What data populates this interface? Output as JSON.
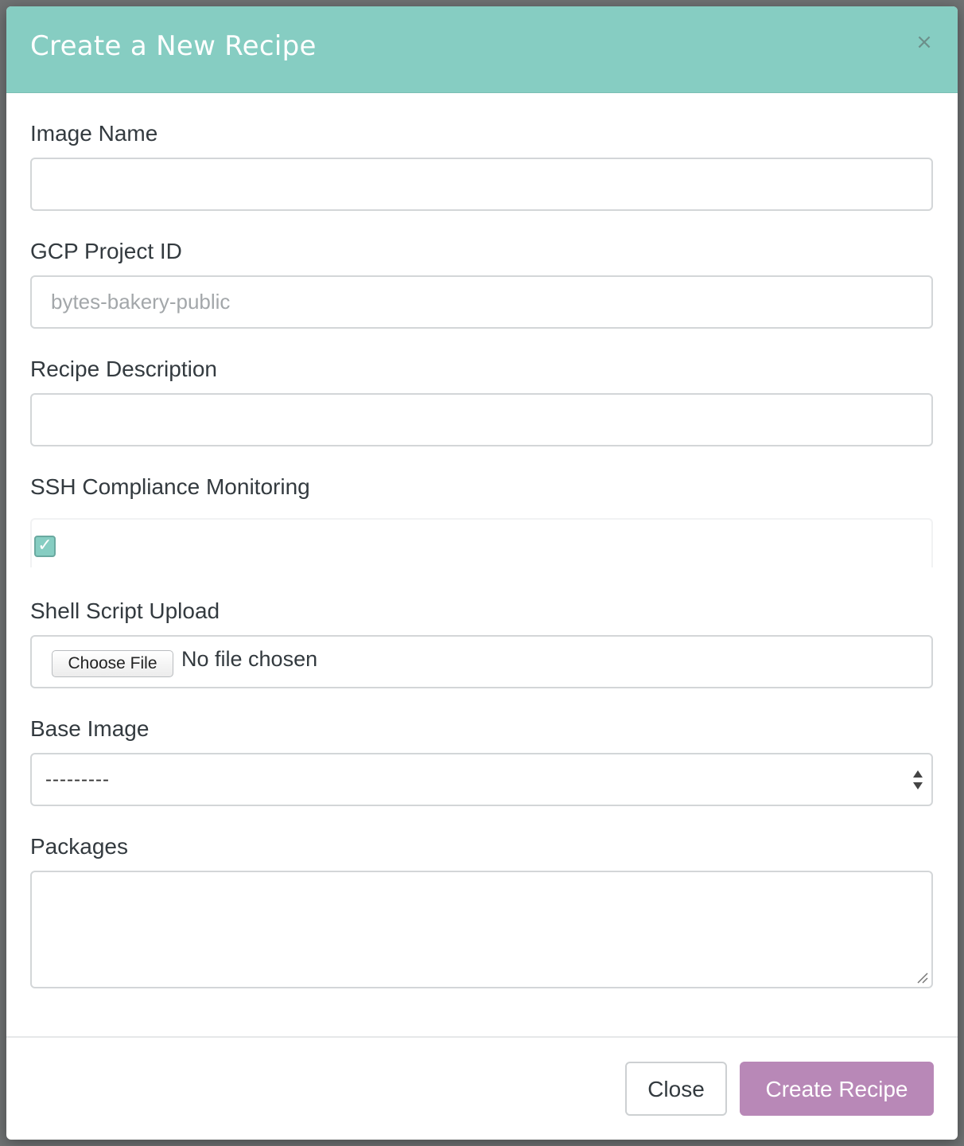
{
  "modal": {
    "title": "Create a New Recipe",
    "close_icon": "×"
  },
  "form": {
    "image_name": {
      "label": "Image Name",
      "value": "",
      "placeholder": ""
    },
    "gcp_project_id": {
      "label": "GCP Project ID",
      "value": "",
      "placeholder": "bytes-bakery-public"
    },
    "recipe_description": {
      "label": "Recipe Description",
      "value": "",
      "placeholder": ""
    },
    "ssh_compliance": {
      "label": "SSH Compliance Monitoring",
      "checked": true,
      "check_glyph": "✓"
    },
    "shell_script": {
      "label": "Shell Script Upload",
      "button_label": "Choose File",
      "status": "No file chosen"
    },
    "base_image": {
      "label": "Base Image",
      "selected": "---------"
    },
    "packages": {
      "label": "Packages",
      "value": ""
    }
  },
  "footer": {
    "close_label": "Close",
    "create_label": "Create Recipe"
  },
  "colors": {
    "header": "#86cdc2",
    "primary_button": "#b888b7",
    "checkbox": "#86cdc2"
  }
}
